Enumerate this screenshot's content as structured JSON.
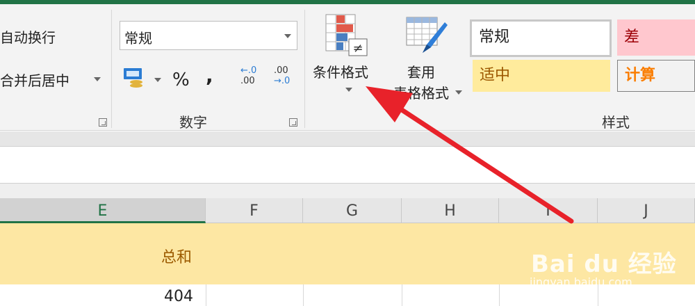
{
  "ribbon": {
    "alignment": {
      "wrap_text": "自动换行",
      "merge_center": "合并后居中"
    },
    "number": {
      "format_value": "常规",
      "percent": "%",
      "comma": ",",
      "inc_decimal_top": "←.0",
      "inc_decimal_bottom": ".00",
      "dec_decimal_top": ".00",
      "dec_decimal_bottom": "→.0",
      "group_label": "数字"
    },
    "styles": {
      "conditional_format": "条件格式",
      "format_table_line1": "套用",
      "format_table_line2": "表格格式",
      "cell_normal": "常规",
      "cell_bad": "差",
      "cell_neutral": "适中",
      "cell_calc": "计算",
      "group_label": "样式"
    }
  },
  "sheet": {
    "columns": [
      "E",
      "F",
      "G",
      "H",
      "I",
      "J"
    ],
    "header_cell": "总和",
    "value_cell": "404"
  },
  "watermark": {
    "brand": "Bai du 经验",
    "url": "jingyan.baidu.com"
  },
  "colors": {
    "accent_green": "#217346",
    "arrow_red": "#e8222a",
    "header_fill": "#fde7a3",
    "bad_fill": "#ffc7ce",
    "neutral_fill": "#ffeb9c",
    "calc_text": "#fa7d00"
  }
}
